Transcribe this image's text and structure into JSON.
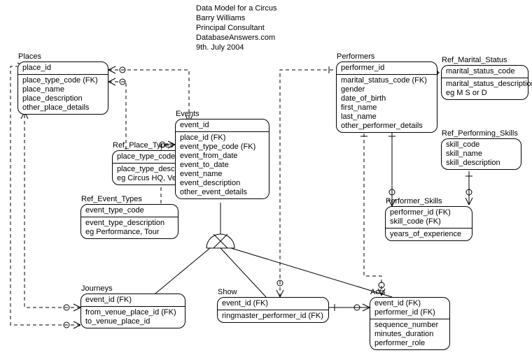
{
  "header": {
    "line1": "Data Model for a Circus",
    "line2": "Barry Williams",
    "line3": "Principal Consultant",
    "line4": "DatabaseAnswers.com",
    "line5": "9th. July 2004"
  },
  "entities": {
    "places": {
      "label": "Places",
      "pk": "place_id",
      "f1": "place_type_code (FK)",
      "f2": "place_name",
      "f3": "place_description",
      "f4": "other_place_details"
    },
    "ref_place_types": {
      "label": "Ref_Place_Types",
      "pk": "place_type_code",
      "f1": "place_type_description",
      "f2": "eg Circus HQ, Venue"
    },
    "ref_event_types": {
      "label": "Ref_Event_Types",
      "pk": "event_type_code",
      "f1": "event_type_description",
      "f2": "eg Performance, Tour"
    },
    "events": {
      "label": "Events",
      "pk": "event_id",
      "f1": "place_id (FK)",
      "f2": "event_type_code (FK)",
      "f3": "event_from_date",
      "f4": "event_to_date",
      "f5": "event_name",
      "f6": "event_description",
      "f7": "other_event_details"
    },
    "performers": {
      "label": "Performers",
      "pk": "performer_id",
      "f1": "marital_status_code (FK)",
      "f2": "gender",
      "f3": "date_of_birth",
      "f4": "first_name",
      "f5": "last_name",
      "f6": "other_performer_details"
    },
    "ref_marital_status": {
      "label": "Ref_Marital_Status",
      "pk": "marital_status_code",
      "f1": "marital_status_description",
      "f2": "eg M S or D"
    },
    "ref_performing_skills": {
      "label": "Ref_Performing_Skills",
      "pk": "skill_code",
      "f1": "skill_name",
      "f2": "skill_description"
    },
    "performer_skills": {
      "label": "Performer_Skills",
      "f1": "performer_id (FK)",
      "f2": "skill_code (FK)",
      "f3": "years_of_experience"
    },
    "journeys": {
      "label": "Journeys",
      "pk": "event_id (FK)",
      "f1": "from_venue_place_id (FK)",
      "f2": "to_venue_place_id"
    },
    "show": {
      "label": "Show",
      "f1": "event_id (FK)",
      "f2": "ringmaster_performer_id (FK)"
    },
    "acts": {
      "label": "Acts",
      "f1": "event_id (FK)",
      "f2": "performer_id (FK)",
      "f3": "sequence_number",
      "f4": "minutes_duration",
      "f5": "performer_role"
    }
  }
}
